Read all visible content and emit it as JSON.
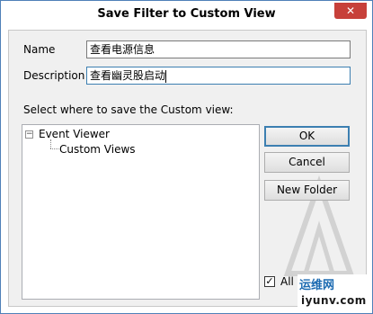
{
  "window": {
    "title": "Save Filter to Custom View",
    "close_glyph": "✕"
  },
  "form": {
    "name_label": "Name",
    "name_value": "查看电源信息",
    "description_label": "Description",
    "description_value": "查看幽灵股启动",
    "location_label": "Select where to save the Custom view:"
  },
  "tree": {
    "toggle_glyph": "−",
    "root": "Event Viewer",
    "child": "Custom Views"
  },
  "buttons": {
    "ok": "OK",
    "cancel": "Cancel",
    "new_folder": "New Folder"
  },
  "all_users": {
    "label": "All Users",
    "checked": true,
    "check_glyph": "✓"
  },
  "badge": {
    "top": "运维网",
    "bottom": "iyunv.com"
  },
  "icons": {
    "close": "close-icon",
    "tree_toggle": "collapse-icon",
    "checkbox": "checkmark-icon"
  },
  "colors": {
    "accent": "#3c7fb1",
    "close": "#c7403a",
    "border": "#4f80b8"
  }
}
